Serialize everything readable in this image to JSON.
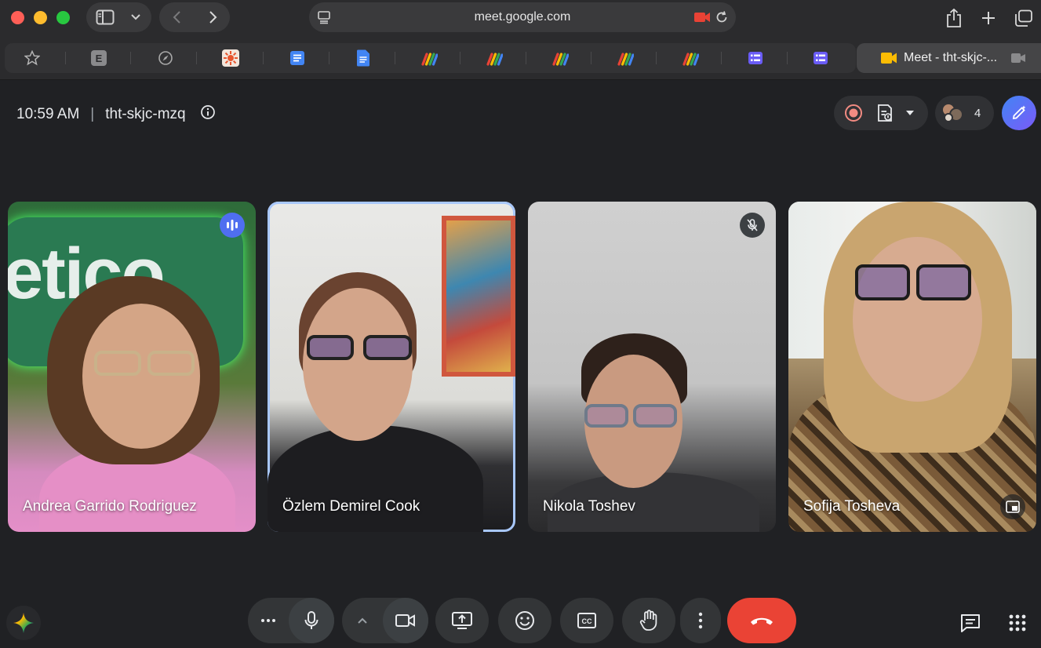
{
  "browser": {
    "url": "meet.google.com",
    "active_tab_title": "Meet - tht-skjc-...",
    "bookmark_letter": "E"
  },
  "meeting": {
    "time": "10:59 AM",
    "separator": "|",
    "code": "tht-skjc-mzq",
    "participant_count": "4"
  },
  "participants": [
    {
      "name": "Andrea Garrido Rodriguez",
      "status": "speaking"
    },
    {
      "name": "Özlem Demirel Cook",
      "status": "pinned"
    },
    {
      "name": "Nikola Toshev",
      "status": "muted"
    },
    {
      "name": "Sofija Tosheva",
      "status": "self"
    }
  ],
  "background_text": "etico",
  "colors": {
    "end_call": "#ea4335",
    "active_speaker_outline": "#a8c7fa",
    "speaking_badge": "#4f6ef0"
  },
  "icons": {
    "speaking": "audio-bars-icon",
    "muted": "mic-off-icon"
  }
}
